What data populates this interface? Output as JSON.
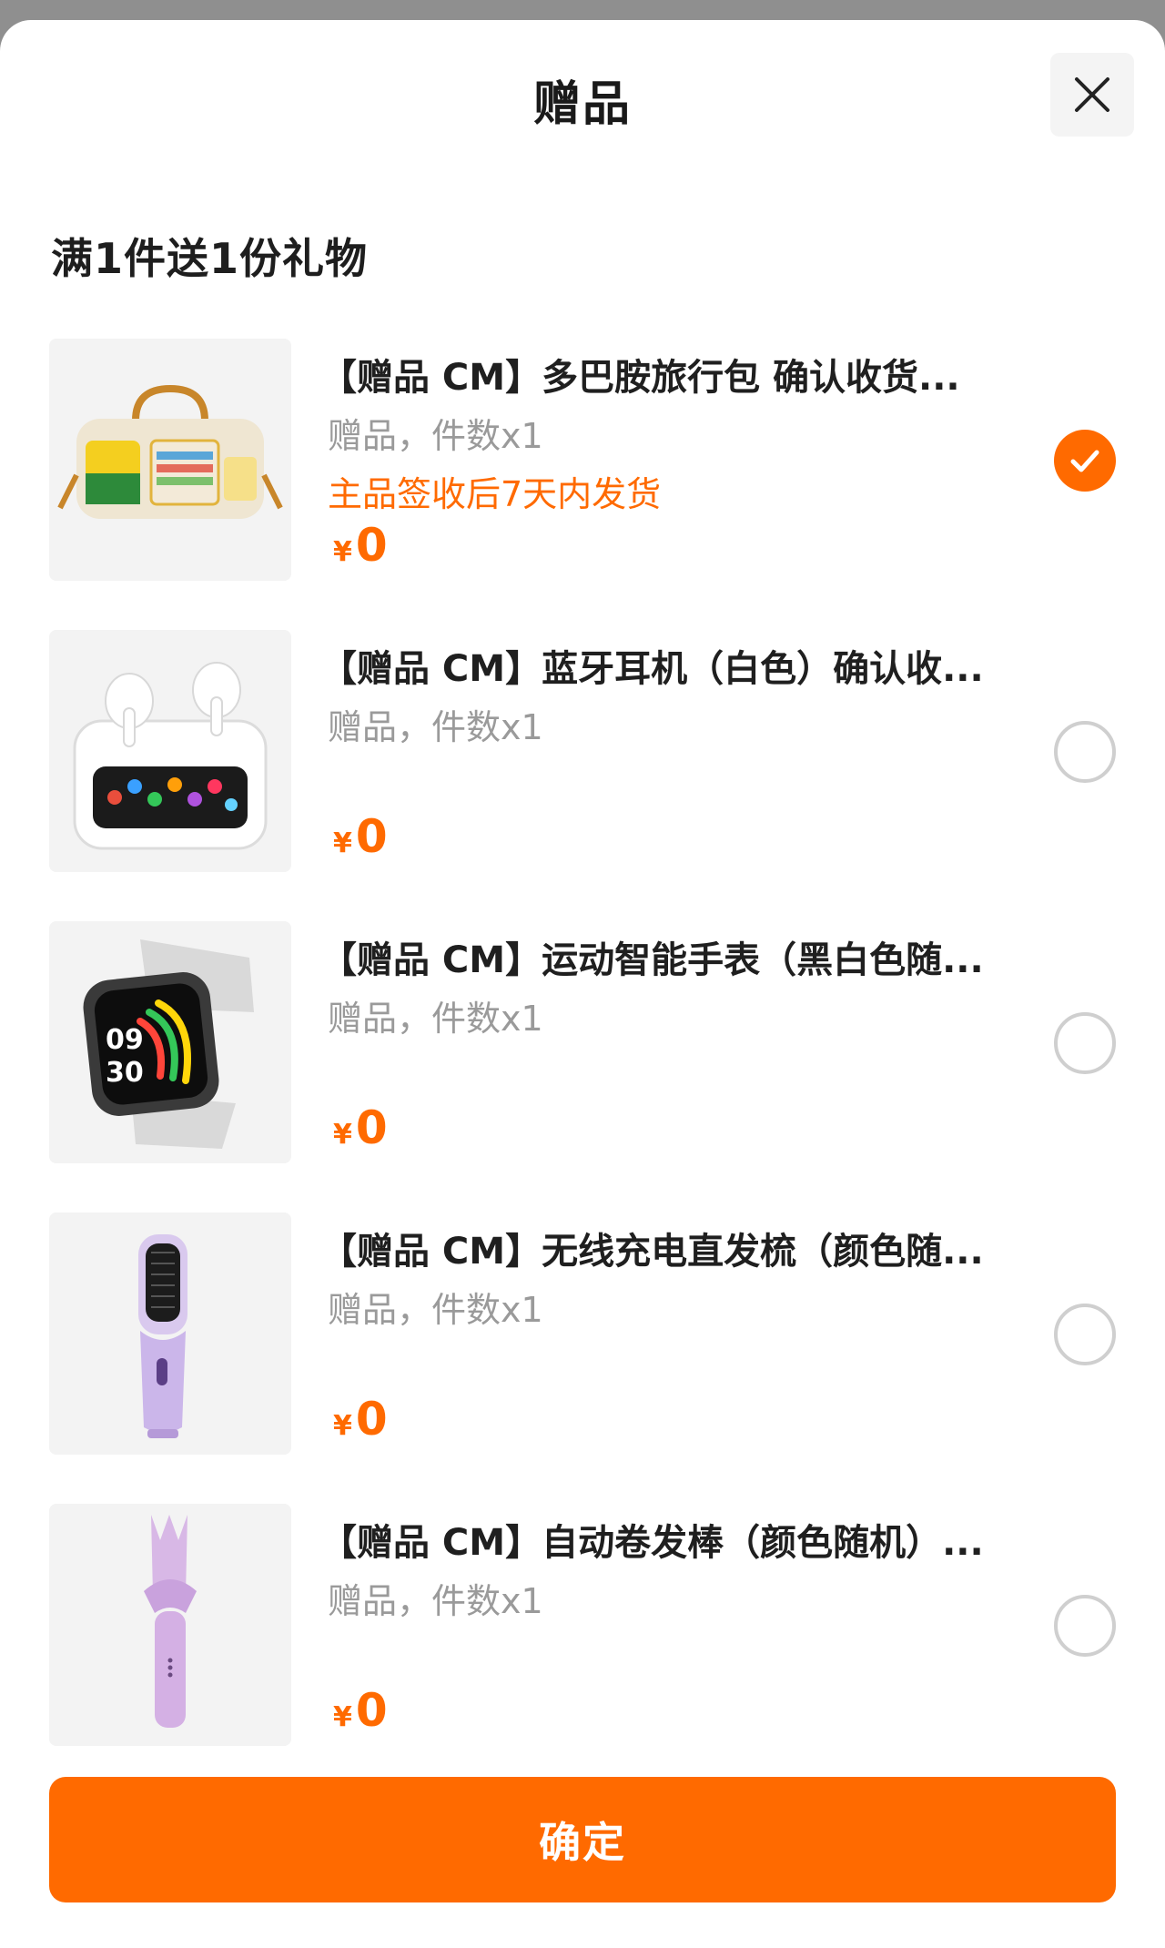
{
  "sheet": {
    "title": "赠品",
    "close_icon": "close-icon",
    "subtitle": "满1件送1份礼物"
  },
  "gifts": [
    {
      "title": "【赠品 CM】多巴胺旅行包 确认收货...",
      "meta": "赠品，件数x1",
      "note": "主品签收后7天内发货",
      "currency": "¥",
      "price": "0",
      "selected": true,
      "image": "travel-bag-image"
    },
    {
      "title": "【赠品 CM】蓝牙耳机（白色）确认收...",
      "meta": "赠品，件数x1",
      "note": "",
      "currency": "¥",
      "price": "0",
      "selected": false,
      "image": "bluetooth-earbuds-image"
    },
    {
      "title": "【赠品 CM】运动智能手表（黑白色随...",
      "meta": "赠品，件数x1",
      "note": "",
      "currency": "¥",
      "price": "0",
      "selected": false,
      "image": "smart-watch-image"
    },
    {
      "title": "【赠品 CM】无线充电直发梳（颜色随...",
      "meta": "赠品，件数x1",
      "note": "",
      "currency": "¥",
      "price": "0",
      "selected": false,
      "image": "hair-straightener-brush-image"
    },
    {
      "title": "【赠品 CM】自动卷发棒（颜色随机）...",
      "meta": "赠品，件数x1",
      "note": "",
      "currency": "¥",
      "price": "0",
      "selected": false,
      "image": "auto-curler-image"
    }
  ],
  "footer": {
    "confirm_label": "确定"
  },
  "colors": {
    "accent": "#ff6a00",
    "radio_border": "#cfcfcf",
    "meta_text": "#9a9a9a",
    "overlay": "#8f8f8f"
  }
}
